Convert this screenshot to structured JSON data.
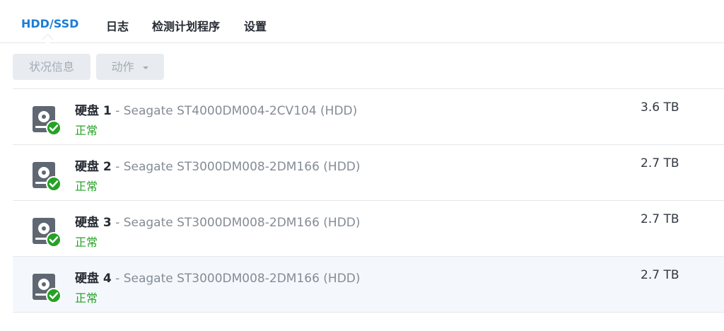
{
  "tabs": [
    {
      "label": "HDD/SSD",
      "active": true
    },
    {
      "label": "日志",
      "active": false
    },
    {
      "label": "检测计划程序",
      "active": false
    },
    {
      "label": "设置",
      "active": false
    }
  ],
  "toolbar": {
    "status_label": "状况信息",
    "action_label": "动作",
    "action_icon": "caret-down-icon"
  },
  "disks": [
    {
      "name": "硬盘 1",
      "model": " - Seagate ST4000DM004-2CV104 (HDD)",
      "status": "正常",
      "size": "3.6 TB"
    },
    {
      "name": "硬盘 2",
      "model": " - Seagate ST3000DM008-2DM166 (HDD)",
      "status": "正常",
      "size": "2.7 TB"
    },
    {
      "name": "硬盘 3",
      "model": " - Seagate ST3000DM008-2DM166 (HDD)",
      "status": "正常",
      "size": "2.7 TB"
    },
    {
      "name": "硬盘 4",
      "model": " - Seagate ST3000DM008-2DM166 (HDD)",
      "status": "正常",
      "size": "2.7 TB"
    }
  ],
  "colors": {
    "accent": "#1a7ed6",
    "status_ok": "#27a127",
    "icon_gray": "#5f6772",
    "selected_row": "#f4f8fc"
  }
}
